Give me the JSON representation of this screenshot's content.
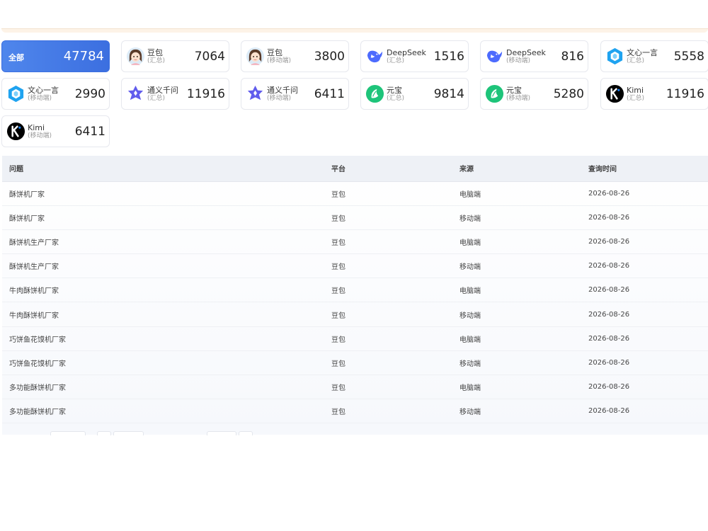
{
  "summary": {
    "all_label": "全部",
    "all_count": "47784",
    "cards": [
      {
        "name": "豆包",
        "sub": "(汇总)",
        "count": "7064",
        "icon": "doubao-avatar-icon"
      },
      {
        "name": "豆包",
        "sub": "(移动端)",
        "count": "3800",
        "icon": "doubao-avatar-icon"
      },
      {
        "name": "DeepSeek",
        "sub": "(汇总)",
        "count": "1516",
        "icon": "deepseek-whale-icon"
      },
      {
        "name": "DeepSeek",
        "sub": "(移动端)",
        "count": "816",
        "icon": "deepseek-whale-icon"
      },
      {
        "name": "文心一言",
        "sub": "(汇总)",
        "count": "5558",
        "icon": "wenxin-hexagon-icon"
      },
      {
        "name": "文心一言",
        "sub": "(移动端)",
        "count": "2990",
        "icon": "wenxin-hexagon-icon"
      },
      {
        "name": "通义千问",
        "sub": "(汇总)",
        "count": "11916",
        "icon": "tongyi-star-icon"
      },
      {
        "name": "通义千问",
        "sub": "(移动端)",
        "count": "6411",
        "icon": "tongyi-star-icon"
      },
      {
        "name": "元宝",
        "sub": "(汇总)",
        "count": "9814",
        "icon": "yuanbao-leaf-icon"
      },
      {
        "name": "元宝",
        "sub": "(移动端)",
        "count": "5280",
        "icon": "yuanbao-leaf-icon"
      },
      {
        "name": "Kimi",
        "sub": "(汇总)",
        "count": "11916",
        "icon": "kimi-k-icon"
      },
      {
        "name": "Kimi",
        "sub": "(移动端)",
        "count": "6411",
        "icon": "kimi-k-icon"
      }
    ]
  },
  "table": {
    "headers": [
      "问题",
      "平台",
      "来源",
      "查询时间"
    ],
    "rows": [
      [
        "酥饼机厂家",
        "豆包",
        "电脑端",
        "2026-08-26"
      ],
      [
        "酥饼机厂家",
        "豆包",
        "移动端",
        "2026-08-26"
      ],
      [
        "酥饼机生产厂家",
        "豆包",
        "电脑端",
        "2026-08-26"
      ],
      [
        "酥饼机生产厂家",
        "豆包",
        "移动端",
        "2026-08-26"
      ],
      [
        "牛肉酥饼机厂家",
        "豆包",
        "电脑端",
        "2026-08-26"
      ],
      [
        "牛肉酥饼机厂家",
        "豆包",
        "移动端",
        "2026-08-26"
      ],
      [
        "巧饼鱼花馍机厂家",
        "豆包",
        "电脑端",
        "2026-08-26"
      ],
      [
        "巧饼鱼花馍机厂家",
        "豆包",
        "移动端",
        "2026-08-26"
      ],
      [
        "多功能酥饼机厂家",
        "豆包",
        "电脑端",
        "2026-08-26"
      ],
      [
        "多功能酥饼机厂家",
        "豆包",
        "移动端",
        "2026-08-26"
      ]
    ]
  },
  "colors": {
    "active_card": "#3c6fe0",
    "deepseek": "#4d6bfe",
    "wenxin": "#1fa3f0",
    "tongyi": "#615ced",
    "yuanbao": "#1ec47a",
    "kimi": "#000000"
  }
}
